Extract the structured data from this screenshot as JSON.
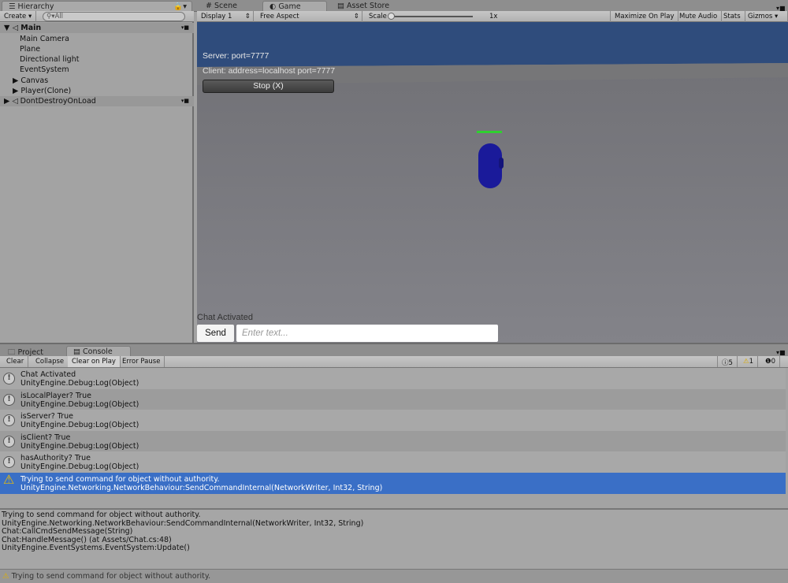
{
  "hierarchy": {
    "tab": "Hierarchy",
    "create": "Create",
    "search_placeholder": "All",
    "scenes": [
      {
        "name": "Main",
        "items": [
          "Main Camera",
          "Plane",
          "Directional light",
          "EventSystem",
          "Canvas",
          "Player(Clone)"
        ]
      },
      {
        "name": "DontDestroyOnLoad"
      }
    ]
  },
  "tabs": {
    "scene": "Scene",
    "game": "Game",
    "asset_store": "Asset Store"
  },
  "game_toolbar": {
    "display": "Display 1",
    "aspect": "Free Aspect",
    "scale_label": "Scale",
    "scale_value": "1x",
    "maximize": "Maximize On Play",
    "mute": "Mute Audio",
    "stats": "Stats",
    "gizmos": "Gizmos"
  },
  "game_view": {
    "server": "Server: port=7777",
    "client": "Client: address=localhost port=7777",
    "stop": "Stop (X)",
    "chat_label": "Chat Activated",
    "send": "Send",
    "input_placeholder": "Enter text...",
    "health_color": "#2fd12f",
    "player_color": "#1a1a9a",
    "sky_color": "#2f4c7c"
  },
  "bottom_tabs": {
    "project": "Project",
    "console": "Console"
  },
  "console": {
    "clear": "Clear",
    "collapse": "Collapse",
    "clear_on_play": "Clear on Play",
    "error_pause": "Error Pause",
    "log_count": "5",
    "warn_count": "1",
    "error_count": "0",
    "entries": [
      {
        "type": "log",
        "line1": "Chat Activated",
        "line2": "UnityEngine.Debug:Log(Object)"
      },
      {
        "type": "log",
        "line1": "isLocalPlayer? True",
        "line2": "UnityEngine.Debug:Log(Object)"
      },
      {
        "type": "log",
        "line1": "isServer? True",
        "line2": "UnityEngine.Debug:Log(Object)"
      },
      {
        "type": "log",
        "line1": "isClient? True",
        "line2": "UnityEngine.Debug:Log(Object)"
      },
      {
        "type": "log",
        "line1": "hasAuthority? True",
        "line2": "UnityEngine.Debug:Log(Object)"
      },
      {
        "type": "warning",
        "line1": "Trying to send command for object without authority.",
        "line2": "UnityEngine.Networking.NetworkBehaviour:SendCommandInternal(NetworkWriter, Int32, String)"
      }
    ],
    "detail": [
      "Trying to send command for object without authority.",
      "UnityEngine.Networking.NetworkBehaviour:SendCommandInternal(NetworkWriter, Int32, String)",
      "Chat:CallCmdSendMessage(String)",
      "Chat:HandleMessage() (at Assets/Chat.cs:48)",
      "UnityEngine.EventSystems.EventSystem:Update()"
    ],
    "status": "Trying to send command for object without authority.",
    "selected_color": "#3a6fc6"
  }
}
